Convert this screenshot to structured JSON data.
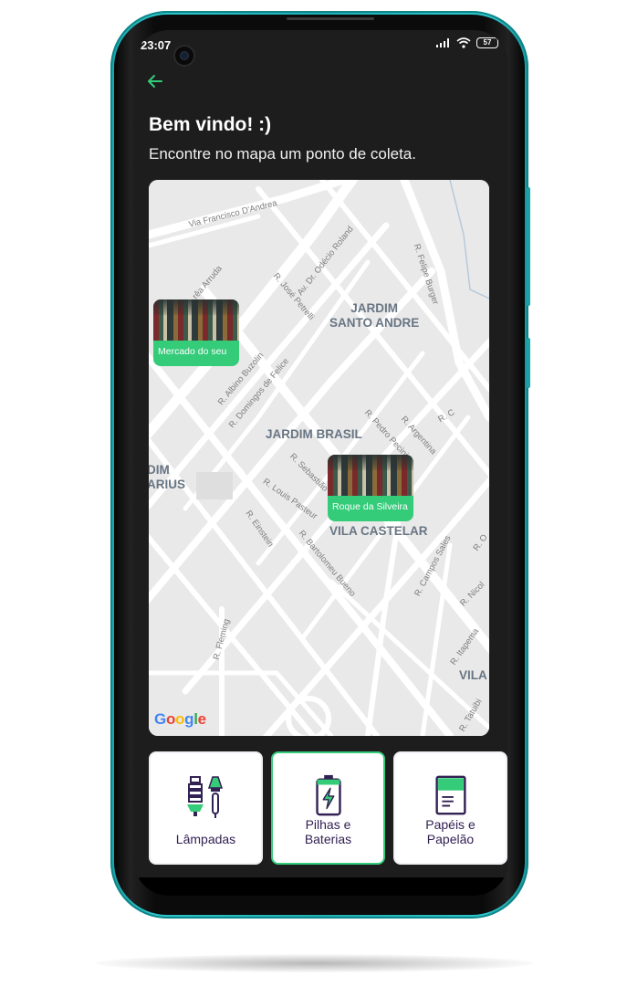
{
  "status": {
    "time": "23:07",
    "battery": "57"
  },
  "header": {
    "title": "Bem vindo! :)",
    "subtitle": "Encontre no mapa um ponto de coleta."
  },
  "map": {
    "neighborhoods": [
      "JARDIM\nSANTO ANDRE",
      "JARDIM BRASIL",
      "VILA CASTELAR",
      "DIM\nARIUS",
      "VILA"
    ],
    "streets": [
      "Via Francisco D'Andrea",
      "Av. Dr. Odécio Roland",
      "R. José Petrelli",
      "R. Felipe Burger",
      "rêa Arruda",
      "R. Albino Buzolin",
      "R. Domingos de Felice",
      "R. Pedro Pecini",
      "R. Argentina",
      "R. C",
      "R. Sebastião",
      "R. Louis Pasteur",
      "R. Einstein",
      "R. Bartolomeu Bueno",
      "R. Campos Sales",
      "R. O",
      "R. Nicol",
      "R. Itapema",
      "R. Fleming",
      "R. Tatuibi"
    ],
    "markers": [
      {
        "name": "Mercado do seu"
      },
      {
        "name": "Roque da Silveira"
      }
    ],
    "attribution": "Google"
  },
  "items": [
    {
      "label": "Lâmpadas",
      "icon": "light-bulbs-icon",
      "selected": false
    },
    {
      "label": "Pilhas e\nBaterias",
      "icon": "battery-icon",
      "selected": true
    },
    {
      "label": "Papéis e\nPapelão",
      "icon": "paper-icon",
      "selected": false
    }
  ],
  "colors": {
    "accent": "#34cb79",
    "item_text": "#322153",
    "frame": "#2cc6c9"
  }
}
